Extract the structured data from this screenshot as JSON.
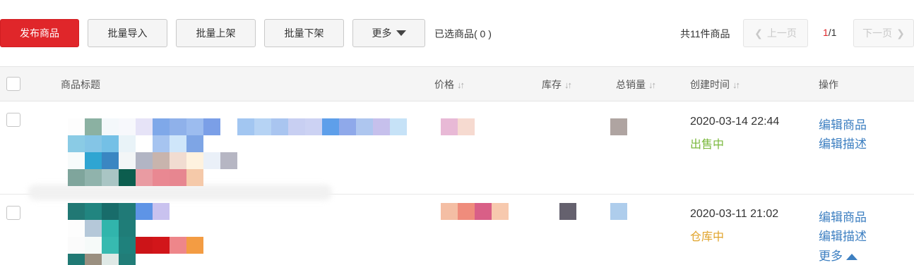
{
  "toolbar": {
    "publish_label": "发布商品",
    "import_label": "批量导入",
    "shelve_label": "批量上架",
    "unshelve_label": "批量下架",
    "more_label": "更多",
    "selected_text": "已选商品( 0 )",
    "total_text": "共11件商品"
  },
  "pager": {
    "prev_label": "上一页",
    "next_label": "下一页",
    "current": "1",
    "total": "/1"
  },
  "table": {
    "headers": {
      "title": "商品标题",
      "price": "价格",
      "stock": "库存",
      "sales": "总销量",
      "created": "创建时间",
      "actions": "操作"
    },
    "rows": [
      {
        "created": "2020-03-14 22:44",
        "status": "出售中",
        "status_color": "#7ab83c",
        "edit_goods": "编辑商品",
        "edit_desc": "编辑描述"
      },
      {
        "created": "2020-03-11 21:02",
        "status": "仓库中",
        "status_color": "#e0a32a",
        "edit_goods": "编辑商品",
        "edit_desc": "编辑描述",
        "more": "更多"
      }
    ]
  },
  "colors": {
    "primary": "#e0262a",
    "link": "#3d7fc1"
  }
}
